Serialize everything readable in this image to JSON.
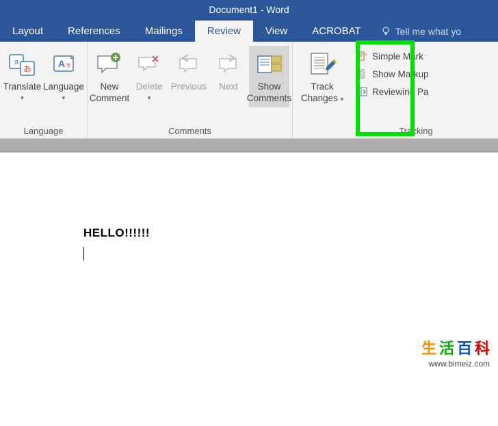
{
  "title": "Document1  -  Word",
  "tabs": {
    "layout": "Layout",
    "references": "References",
    "mailings": "Mailings",
    "review": "Review",
    "view": "View",
    "acrobat": "ACROBAT",
    "tellme": "Tell me what yo"
  },
  "ribbon": {
    "language": {
      "translate": "Translate",
      "language": "Language",
      "group": "Language"
    },
    "comments": {
      "new": "New",
      "new2": "Comment",
      "delete": "Delete",
      "previous": "Previous",
      "next": "Next",
      "show": "Show",
      "show2": "Comments",
      "group": "Comments"
    },
    "tracking": {
      "track": "Track",
      "track2": "Changes",
      "simple_markup": "Simple Mark",
      "show_markup": "Show Markup",
      "reviewing_pane": "Reviewing Pa",
      "group": "Tracking"
    }
  },
  "document": {
    "line1": "HELLO!!!!!!"
  },
  "watermark": {
    "c1": "生",
    "c2": "活",
    "c3": "百",
    "c4": "科",
    "url": "www.bimeiz.com"
  }
}
